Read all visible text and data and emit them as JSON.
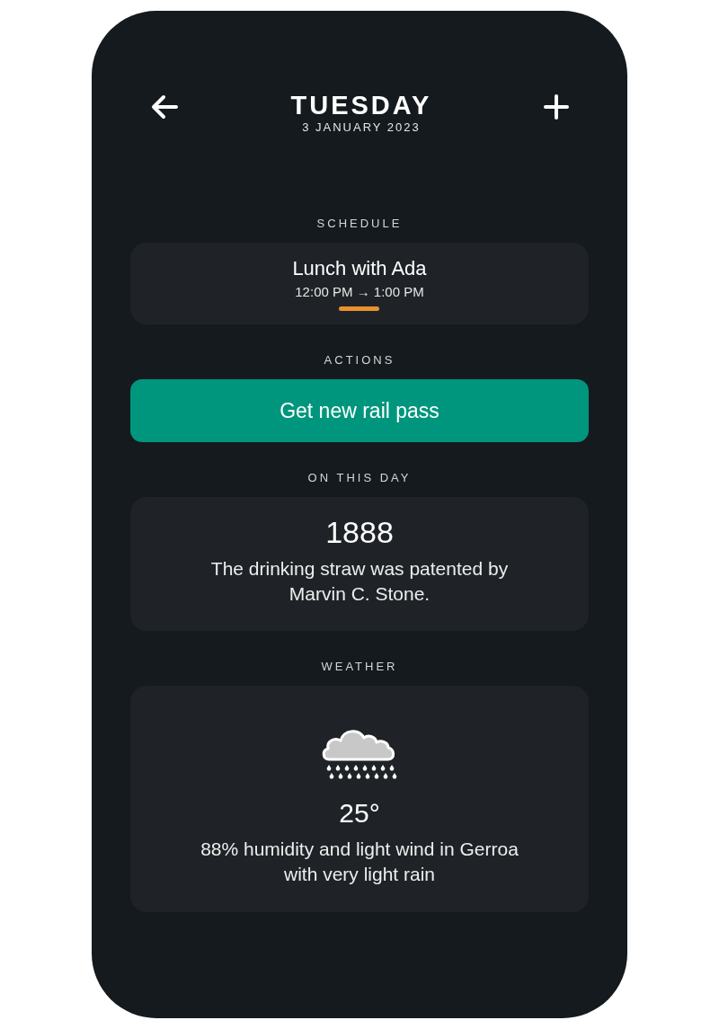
{
  "header": {
    "title": "TUESDAY",
    "date": "3 JANUARY 2023"
  },
  "sections": [
    {
      "kind": "schedule",
      "label": "SCHEDULE",
      "events": [
        {
          "title": "Lunch with Ada",
          "time": "12:00 PM → 1:00 PM",
          "color": "#e8912d"
        }
      ]
    },
    {
      "kind": "actions",
      "label": "ACTIONS",
      "buttons": [
        "Get new rail pass"
      ]
    },
    {
      "kind": "history",
      "label": "ON THIS DAY",
      "year": "1888",
      "text": "The drinking straw was patented by Marvin C. Stone."
    },
    {
      "kind": "weather",
      "label": "WEATHER",
      "temperature": "25°",
      "summary": "88% humidity and light wind in Gerroa with very light rain"
    }
  ]
}
